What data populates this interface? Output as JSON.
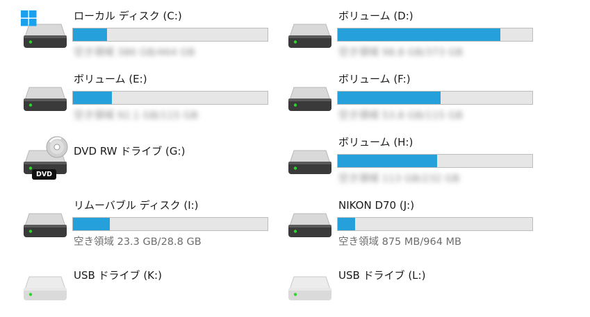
{
  "drives": [
    {
      "id": "c",
      "label": "ローカル ディスク (C:)",
      "type": "hdd-system",
      "used_fraction": 0.175,
      "free_text": "空き領域 386 GB/464 GB",
      "free_blurred": true
    },
    {
      "id": "d",
      "label": "ボリューム (D:)",
      "type": "hdd",
      "used_fraction": 0.835,
      "free_text": "空き領域 98.8 GB/373 GB",
      "free_blurred": true
    },
    {
      "id": "e",
      "label": "ボリューム (E:)",
      "type": "hdd",
      "used_fraction": 0.2,
      "free_text": "空き領域 92.1 GB/115 GB",
      "free_blurred": true
    },
    {
      "id": "f",
      "label": "ボリューム (F:)",
      "type": "hdd",
      "used_fraction": 0.53,
      "free_text": "空き領域 53.8 GB/115 GB",
      "free_blurred": true
    },
    {
      "id": "g",
      "label": "DVD RW ドライブ (G:)",
      "type": "dvd",
      "badge": "DVD"
    },
    {
      "id": "h",
      "label": "ボリューム (H:)",
      "type": "hdd",
      "used_fraction": 0.51,
      "free_text": "空き領域 113 GB/232 GB",
      "free_blurred": true
    },
    {
      "id": "i",
      "label": "リムーバブル ディスク (I:)",
      "type": "removable",
      "used_fraction": 0.19,
      "free_text": "空き領域 23.3 GB/28.8 GB",
      "free_blurred": false
    },
    {
      "id": "j",
      "label": "NIKON D70 (J:)",
      "type": "removable",
      "used_fraction": 0.09,
      "free_text": "空き領域 875 MB/964 MB",
      "free_blurred": false
    },
    {
      "id": "k",
      "label": "USB ドライブ (K:)",
      "type": "usb-empty"
    },
    {
      "id": "l",
      "label": "USB ドライブ (L:)",
      "type": "usb-empty"
    }
  ],
  "colors": {
    "bar_fill": "#26a0da",
    "bar_track": "#e6e6e6",
    "bar_border": "#bcbcbc",
    "led": "#2bd62b"
  },
  "icons": {
    "drive": "hard-drive-icon",
    "windows": "windows-logo-icon",
    "disc": "optical-disc-icon"
  }
}
